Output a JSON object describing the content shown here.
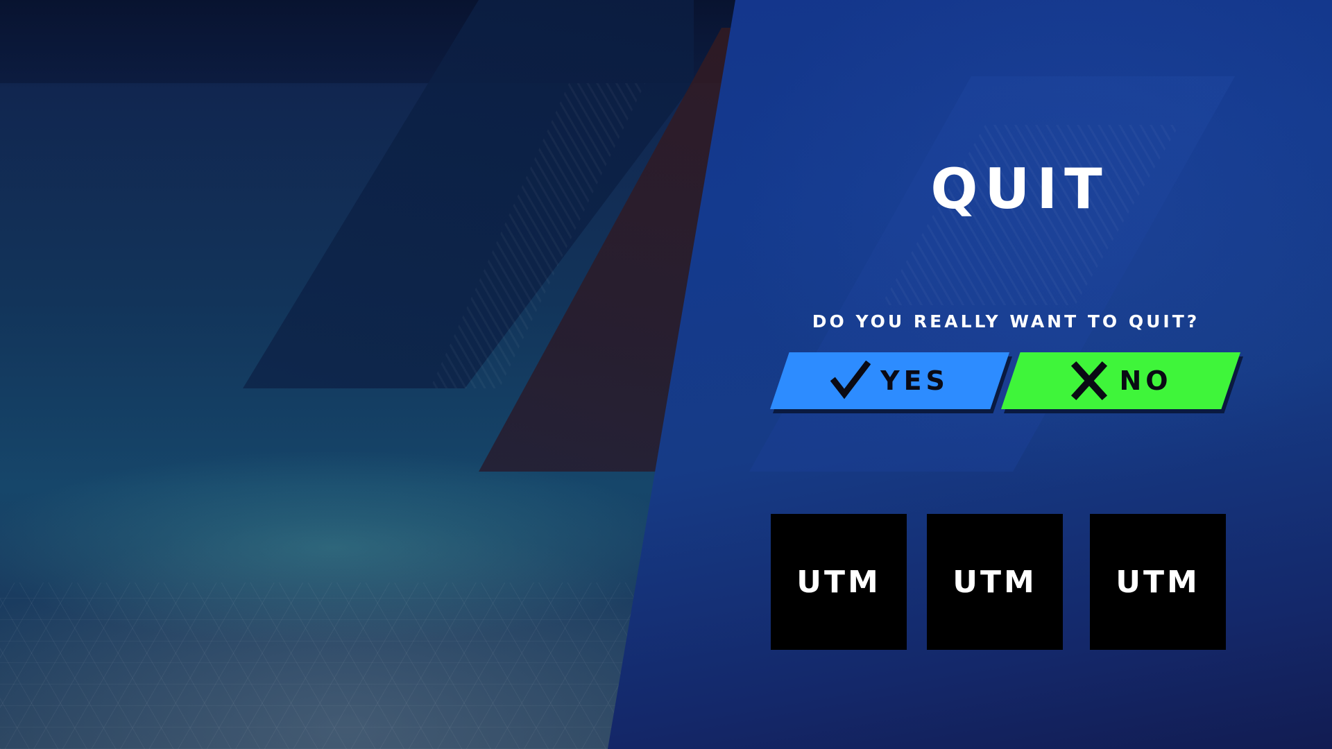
{
  "dialog": {
    "title": "QUIT",
    "prompt": "DO YOU REALLY WANT TO QUIT?"
  },
  "buttons": {
    "yes": {
      "label": "YES",
      "icon": "checkmark-icon",
      "color": "#2d8cff"
    },
    "no": {
      "label": "NO",
      "icon": "x-icon",
      "color": "#3ff53a"
    }
  },
  "tiles": [
    {
      "label": "UTM"
    },
    {
      "label": "UTM"
    },
    {
      "label": "UTM"
    }
  ],
  "theme": {
    "panel_color": "#14348a",
    "text_color": "#ffffff",
    "tile_color": "#000000"
  }
}
